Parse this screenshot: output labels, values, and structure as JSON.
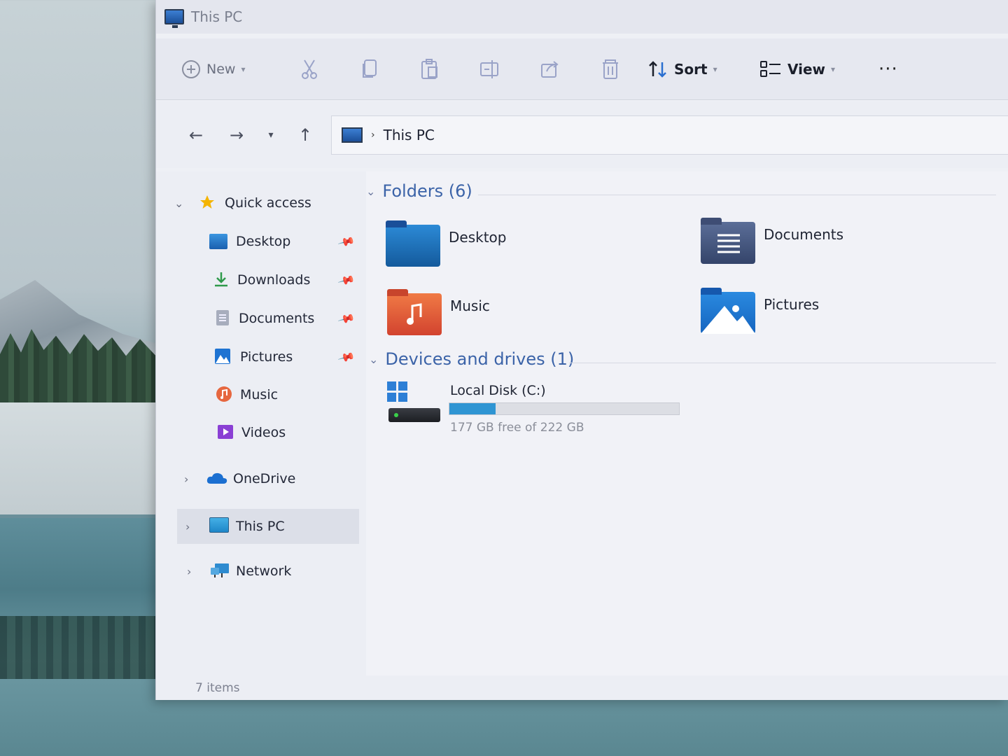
{
  "window": {
    "title": "This PC"
  },
  "toolbar": {
    "new_label": "New",
    "sort_label": "Sort",
    "view_label": "View",
    "more_label": "···"
  },
  "navigation": {
    "breadcrumb": [
      "This PC"
    ]
  },
  "sidebar": {
    "items": [
      {
        "label": "Quick access",
        "icon": "star-icon",
        "expanded": true
      },
      {
        "label": "Desktop",
        "icon": "desktop-folder-icon",
        "pinned": true
      },
      {
        "label": "Downloads",
        "icon": "download-icon",
        "pinned": true
      },
      {
        "label": "Documents",
        "icon": "documents-icon",
        "pinned": true
      },
      {
        "label": "Pictures",
        "icon": "pictures-icon",
        "pinned": true
      },
      {
        "label": "Music",
        "icon": "music-icon"
      },
      {
        "label": "Videos",
        "icon": "videos-icon"
      },
      {
        "label": "OneDrive",
        "icon": "onedrive-cloud-icon"
      },
      {
        "label": "This PC",
        "icon": "computer-icon",
        "selected": true
      },
      {
        "label": "Network",
        "icon": "network-icon"
      }
    ]
  },
  "main": {
    "folders_header": "Folders (6)",
    "folders": [
      {
        "label": "Desktop",
        "icon": "desktop-folder-icon",
        "color": "#2a7fc9"
      },
      {
        "label": "Documents",
        "icon": "documents-folder-icon",
        "color": "#4d5f86"
      },
      {
        "label": "Music",
        "icon": "music-folder-icon",
        "color": "#e2573a"
      },
      {
        "label": "Pictures",
        "icon": "pictures-folder-icon",
        "color": "#1e7fd6"
      }
    ],
    "drives_header": "Devices and drives (1)",
    "drives": [
      {
        "label": "Local Disk (C:)",
        "free_text": "177 GB free of 222 GB",
        "used_fraction": 0.2,
        "bar_color": "#2f95d3"
      }
    ]
  },
  "status": {
    "items_text": "7 items"
  }
}
